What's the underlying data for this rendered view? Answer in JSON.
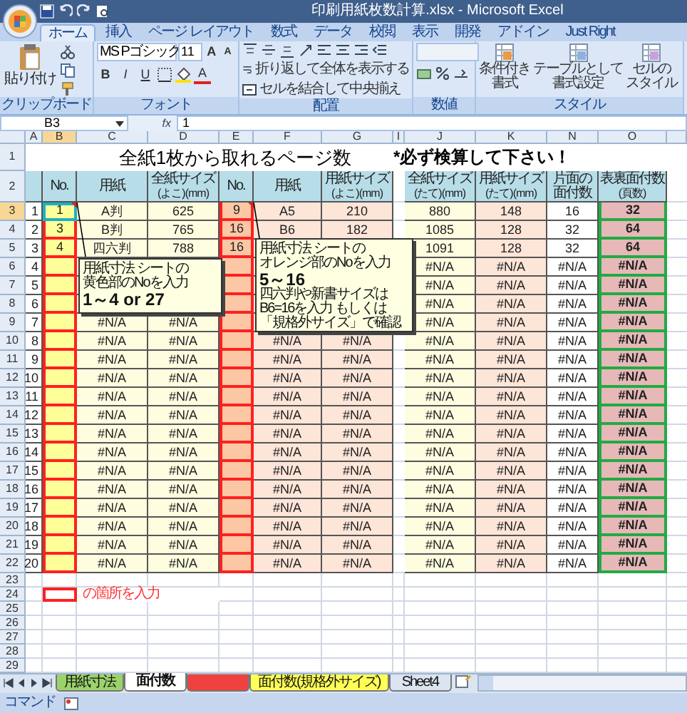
{
  "window": {
    "title": "印刷用紙枚数計算.xlsx - Microsoft Excel"
  },
  "ribbon_tabs": [
    {
      "label": "ホーム",
      "selected": true
    },
    {
      "label": "挿入",
      "selected": false
    },
    {
      "label": "ページ レイアウト",
      "selected": false
    },
    {
      "label": "数式",
      "selected": false
    },
    {
      "label": "データ",
      "selected": false
    },
    {
      "label": "校閲",
      "selected": false
    },
    {
      "label": "表示",
      "selected": false
    },
    {
      "label": "開発",
      "selected": false
    },
    {
      "label": "アドイン",
      "selected": false
    },
    {
      "label": "Just Right",
      "selected": false
    }
  ],
  "clipboard": {
    "label": "クリップボード",
    "paste": "貼り付け"
  },
  "font": {
    "label": "フォント",
    "name": "MS Pゴシック",
    "size": "11",
    "grow": "A",
    "shrink": "A",
    "bold": "B",
    "italic": "I",
    "underline": "U",
    "font_color": "A"
  },
  "alignment": {
    "label": "配置",
    "wrap": "折り返して全体を表示する",
    "merge": "セルを結合して中央揃え"
  },
  "number": {
    "label": "数値"
  },
  "styles": {
    "label": "スタイル",
    "buttons": [
      {
        "lines": [
          "条件付き",
          "書式"
        ]
      },
      {
        "lines": [
          "テーブルとして",
          "書式設定"
        ]
      },
      {
        "lines": [
          "セルの",
          "スタイル"
        ]
      }
    ]
  },
  "formula_bar": {
    "name_box": "B3",
    "fx": "fx",
    "formula": "1"
  },
  "columns": [
    {
      "label": "A",
      "selected": false
    },
    {
      "label": "B",
      "selected": true
    },
    {
      "label": "C",
      "selected": false
    },
    {
      "label": "D",
      "selected": false
    },
    {
      "label": "E",
      "selected": false
    },
    {
      "label": "F",
      "selected": false
    },
    {
      "label": "G",
      "selected": false
    },
    {
      "label": "I",
      "selected": false
    },
    {
      "label": "J",
      "selected": false
    },
    {
      "label": "K",
      "selected": false
    },
    {
      "label": "N",
      "selected": false
    },
    {
      "label": "O",
      "selected": false
    }
  ],
  "top_rows": [
    "1",
    "2"
  ],
  "sheet_title": "全紙1枚から取れるページ数",
  "sheet_note": "*必ず検算して下さい！",
  "headers": {
    "B": [
      "No."
    ],
    "C": [
      "用紙"
    ],
    "D": [
      "全紙サイズ",
      "(よこ)(mm)"
    ],
    "E": [
      "No."
    ],
    "F": [
      "用紙"
    ],
    "G": [
      "用紙サイズ",
      "(よこ)(mm)"
    ],
    "J": [
      "全紙サイズ",
      "(たて)(mm)"
    ],
    "K": [
      "用紙サイズ",
      "(たて)(mm)"
    ],
    "N": [
      "片面の",
      "面付数"
    ],
    "O": [
      "表裏面付数",
      "(頁数)"
    ]
  },
  "rows": [
    {
      "number": "3",
      "selected": true,
      "cells": {
        "A": "1",
        "B": "1",
        "C": "A判",
        "D": "625",
        "E": "9",
        "F": "A5",
        "G": "210",
        "J": "880",
        "K": "148",
        "N": "16",
        "O": "32"
      }
    },
    {
      "number": "4",
      "selected": false,
      "cells": {
        "A": "2",
        "B": "3",
        "C": "B判",
        "D": "765",
        "E": "16",
        "F": "B6",
        "G": "182",
        "J": "1085",
        "K": "128",
        "N": "32",
        "O": "64"
      }
    },
    {
      "number": "5",
      "selected": false,
      "cells": {
        "A": "3",
        "B": "4",
        "C": "四六判",
        "D": "788",
        "E": "16",
        "J": "1091",
        "K": "128",
        "N": "32",
        "O": "64"
      }
    },
    {
      "number": "6",
      "selected": false,
      "cells": {
        "A": "4",
        "J": "#N/A",
        "K": "#N/A",
        "N": "#N/A",
        "O": "#N/A"
      }
    },
    {
      "number": "7",
      "selected": false,
      "cells": {
        "A": "5",
        "J": "#N/A",
        "K": "#N/A",
        "N": "#N/A",
        "O": "#N/A"
      }
    },
    {
      "number": "8",
      "selected": false,
      "cells": {
        "A": "6",
        "J": "#N/A",
        "K": "#N/A",
        "N": "#N/A",
        "O": "#N/A"
      }
    },
    {
      "number": "9",
      "selected": false,
      "cells": {
        "A": "7",
        "C": "#N/A",
        "D": "#N/A",
        "J": "#N/A",
        "K": "#N/A",
        "N": "#N/A",
        "O": "#N/A"
      }
    },
    {
      "number": "10",
      "selected": false,
      "cells": {
        "A": "8",
        "C": "#N/A",
        "D": "#N/A",
        "F": "#N/A",
        "G": "#N/A",
        "J": "#N/A",
        "K": "#N/A",
        "N": "#N/A",
        "O": "#N/A"
      }
    },
    {
      "number": "11",
      "selected": false,
      "cells": {
        "A": "9",
        "C": "#N/A",
        "D": "#N/A",
        "F": "#N/A",
        "G": "#N/A",
        "J": "#N/A",
        "K": "#N/A",
        "N": "#N/A",
        "O": "#N/A"
      }
    },
    {
      "number": "12",
      "selected": false,
      "cells": {
        "A": "10",
        "C": "#N/A",
        "D": "#N/A",
        "F": "#N/A",
        "G": "#N/A",
        "J": "#N/A",
        "K": "#N/A",
        "N": "#N/A",
        "O": "#N/A"
      }
    },
    {
      "number": "13",
      "selected": false,
      "cells": {
        "A": "11",
        "C": "#N/A",
        "D": "#N/A",
        "F": "#N/A",
        "G": "#N/A",
        "J": "#N/A",
        "K": "#N/A",
        "N": "#N/A",
        "O": "#N/A"
      }
    },
    {
      "number": "14",
      "selected": false,
      "cells": {
        "A": "12",
        "C": "#N/A",
        "D": "#N/A",
        "F": "#N/A",
        "G": "#N/A",
        "J": "#N/A",
        "K": "#N/A",
        "N": "#N/A",
        "O": "#N/A"
      }
    },
    {
      "number": "15",
      "selected": false,
      "cells": {
        "A": "13",
        "C": "#N/A",
        "D": "#N/A",
        "F": "#N/A",
        "G": "#N/A",
        "J": "#N/A",
        "K": "#N/A",
        "N": "#N/A",
        "O": "#N/A"
      }
    },
    {
      "number": "16",
      "selected": false,
      "cells": {
        "A": "14",
        "C": "#N/A",
        "D": "#N/A",
        "F": "#N/A",
        "G": "#N/A",
        "J": "#N/A",
        "K": "#N/A",
        "N": "#N/A",
        "O": "#N/A"
      }
    },
    {
      "number": "17",
      "selected": false,
      "cells": {
        "A": "15",
        "C": "#N/A",
        "D": "#N/A",
        "F": "#N/A",
        "G": "#N/A",
        "J": "#N/A",
        "K": "#N/A",
        "N": "#N/A",
        "O": "#N/A"
      }
    },
    {
      "number": "18",
      "selected": false,
      "cells": {
        "A": "16",
        "C": "#N/A",
        "D": "#N/A",
        "F": "#N/A",
        "G": "#N/A",
        "J": "#N/A",
        "K": "#N/A",
        "N": "#N/A",
        "O": "#N/A"
      }
    },
    {
      "number": "19",
      "selected": false,
      "cells": {
        "A": "17",
        "C": "#N/A",
        "D": "#N/A",
        "F": "#N/A",
        "G": "#N/A",
        "J": "#N/A",
        "K": "#N/A",
        "N": "#N/A",
        "O": "#N/A"
      }
    },
    {
      "number": "20",
      "selected": false,
      "cells": {
        "A": "18",
        "C": "#N/A",
        "D": "#N/A",
        "F": "#N/A",
        "G": "#N/A",
        "J": "#N/A",
        "K": "#N/A",
        "N": "#N/A",
        "O": "#N/A"
      }
    },
    {
      "number": "21",
      "selected": false,
      "cells": {
        "A": "19",
        "C": "#N/A",
        "D": "#N/A",
        "F": "#N/A",
        "G": "#N/A",
        "J": "#N/A",
        "K": "#N/A",
        "N": "#N/A",
        "O": "#N/A"
      }
    },
    {
      "number": "22",
      "selected": false,
      "cells": {
        "A": "20",
        "C": "#N/A",
        "D": "#N/A",
        "F": "#N/A",
        "G": "#N/A",
        "J": "#N/A",
        "K": "#N/A",
        "N": "#N/A",
        "O": "#N/A"
      }
    }
  ],
  "empty_rows": [
    "23",
    "24",
    "25",
    "26",
    "27",
    "28",
    "29"
  ],
  "legend": "の箇所を入力",
  "comments": [
    {
      "lines": [
        {
          "text": "用紙寸法 シートの",
          "kind": "normal"
        },
        {
          "text": "黄色部のNoを入力",
          "kind": "normal"
        },
        {
          "text": "1～4 or 27",
          "kind": "large"
        }
      ]
    },
    {
      "lines": [
        {
          "text": "用紙寸法 シートの",
          "kind": "normal"
        },
        {
          "text": "オレンジ部のNoを入力",
          "kind": "normal"
        },
        {
          "text": "5～16",
          "kind": "large"
        },
        {
          "text": "四六判や新書サイズは",
          "kind": "normal"
        },
        {
          "text": "B6=16を入力 もしくは",
          "kind": "normal"
        },
        {
          "text": "「規格外サイズ」で確認",
          "kind": "normal"
        }
      ]
    }
  ],
  "sheet_tabs": [
    {
      "label": "用紙寸法",
      "selected": false,
      "color": "#9bd36b"
    },
    {
      "label": "面付数",
      "selected": true
    },
    {
      "selected": false,
      "color": "#f04040"
    },
    {
      "label": "面付数(規格外サイズ)",
      "selected": false,
      "color": "#ffff55"
    },
    {
      "label": "Sheet4",
      "selected": false
    }
  ],
  "status_bar": {
    "mode": "コマンド"
  }
}
